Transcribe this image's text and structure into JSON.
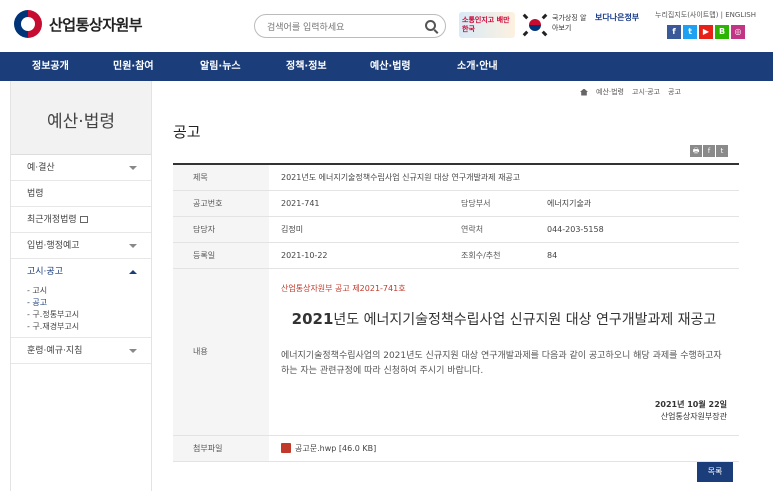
{
  "header": {
    "logo_text": "산업통상자원부",
    "search_placeholder": "검색어를 입력하세요",
    "banner1": "소통인지고 배만한국",
    "banner2": "국가상징 알아보기",
    "banner3": "보다나은정부",
    "util_links": "누리집지도(사이트맵) | ENGLISH",
    "sns": [
      "f",
      "t",
      "▶",
      "B",
      "◎"
    ],
    "sns_colors": [
      "#3b5998",
      "#1da1f2",
      "#e62117",
      "#2db400",
      "#c13584"
    ]
  },
  "gnb": [
    "정보공개",
    "민원·참여",
    "알림·뉴스",
    "정책·정보",
    "예산·법령",
    "소개·안내"
  ],
  "lnb": {
    "title": "예산·법령",
    "items": [
      "예·결산",
      "법령",
      "최근개정법령",
      "입법·행정예고",
      "고시·공고",
      "훈령·예규·지침"
    ],
    "sub": [
      "- 고시",
      "- 공고",
      "- 구.정통부고시",
      "- 구.재경부고시"
    ]
  },
  "breadcrumb": [
    "예산·법령",
    "고시·공고",
    "공고"
  ],
  "page_title": "공고",
  "share": [
    "🖶",
    "f",
    "t"
  ],
  "post": {
    "labels": {
      "subject": "제목",
      "number": "공고번호",
      "dept": "담당부서",
      "manager": "담당자",
      "contact": "연락처",
      "date": "등록일",
      "views": "조회수/추천",
      "content": "내용",
      "attachment": "첨부파일"
    },
    "subject": "2021년도 에너지기술정책수립사업 신규지원 대상 연구개발과제 재공고",
    "number": "2021-741",
    "dept": "에너지기술과",
    "manager": "김정미",
    "contact": "044-203-5158",
    "date": "2021-10-22",
    "views": "84",
    "content": {
      "org": "산업통상자원부 공고 제2021-741호",
      "title_year": "2021",
      "title_rest": "년도 에너지기술정책수립사업 신규지원 대상 연구개발과제 재공고",
      "body": "에너지기술정책수립사업의 2021년도 신규지원 대상 연구개발과제를 다음과 같이 공고하오니 해당 과제를 수행하고자 하는 자는 관련규정에 따라 신청하여 주시기 바랍니다.",
      "sign_date": "2021년 10월 22일",
      "sign_org": "산업통상자원부장관"
    },
    "attachment": "공고문.hwp [46.0 KB]"
  },
  "list_button": "목록"
}
